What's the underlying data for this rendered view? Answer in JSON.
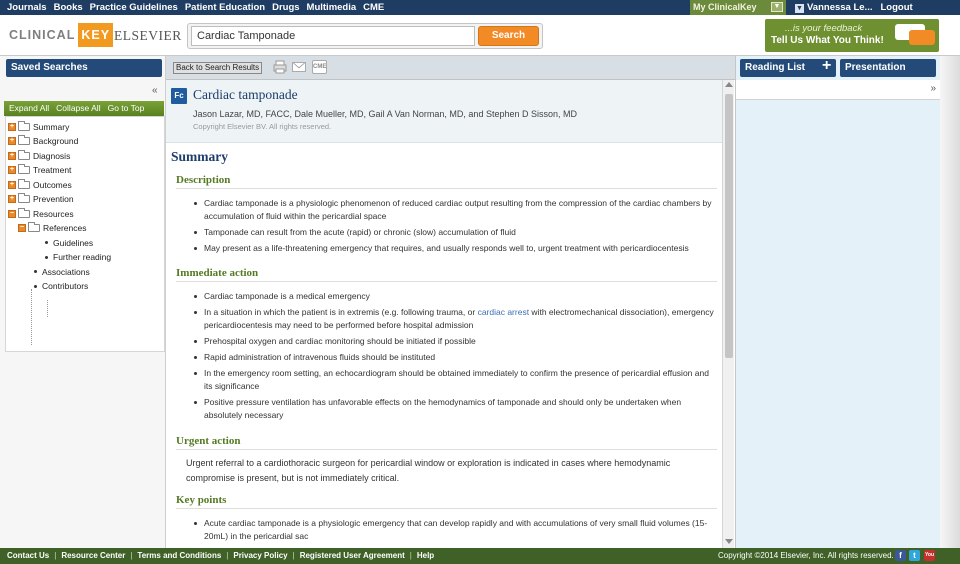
{
  "topnav": {
    "items": [
      "Journals",
      "Books",
      "Practice Guidelines",
      "Patient Education",
      "Drugs",
      "Multimedia",
      "CME"
    ],
    "my_clinicalkey": "My ClinicalKey",
    "user": "Vannessa Le...",
    "logout": "Logout"
  },
  "header": {
    "logo_clinical": "CLINICAL",
    "logo_key": "KEY",
    "logo_elsevier": "ELSEVIER",
    "search_value": "Cardiac Tamponade",
    "search_button": "Search",
    "feedback_line1": "...is your feedback",
    "feedback_line2": "Tell Us What You Think!"
  },
  "left": {
    "saved_searches": "Saved Searches",
    "collapse_icon": "«",
    "expand_all": "Expand All",
    "collapse_all": "Collapse All",
    "go_to_top": "Go to Top",
    "tree": [
      {
        "label": "Summary"
      },
      {
        "label": "Background"
      },
      {
        "label": "Diagnosis"
      },
      {
        "label": "Treatment"
      },
      {
        "label": "Outcomes"
      },
      {
        "label": "Prevention"
      },
      {
        "label": "Resources"
      },
      {
        "label": "References"
      },
      {
        "label": "Guidelines"
      },
      {
        "label": "Further reading"
      },
      {
        "label": "Associations"
      },
      {
        "label": "Contributors"
      }
    ]
  },
  "toolbar": {
    "back": "Back to Search Results",
    "cme_icon": "CME"
  },
  "article": {
    "badge": "Fc",
    "title": "Cardiac tamponade",
    "authors": "Jason Lazar, MD, FACC, Dale Mueller, MD, Gail A Van Norman, MD, and Stephen D Sisson, MD",
    "copyright": "Copyright Elsevier BV. All rights reserved.",
    "summary_heading": "Summary",
    "sections": {
      "description": {
        "heading": "Description",
        "items": [
          "Cardiac tamponade is a physiologic phenomenon of reduced cardiac output resulting from the compression of the cardiac chambers by accumulation of fluid within the pericardial space",
          "Tamponade can result from the acute (rapid) or chronic (slow) accumulation of fluid",
          "May present as a life-threatening emergency that requires, and usually responds well to, urgent treatment with pericardiocentesis"
        ]
      },
      "immediate": {
        "heading": "Immediate action",
        "items": [
          "Cardiac tamponade is a medical emergency",
          "In a situation in which the patient is in extremis (e.g. following trauma, or ",
          "Prehospital oxygen and cardiac monitoring should be initiated if possible",
          "Rapid administration of intravenous fluids should be instituted",
          "In the emergency room setting, an echocardiogram should be obtained immediately to confirm the presence of pericardial effusion and its significance",
          "Positive pressure ventilation has unfavorable effects on the hemodynamics of tamponade and should only be undertaken when absolutely necessary"
        ],
        "link_text": "cardiac arrest",
        "item2_tail": " with electromechanical dissociation), emergency pericardiocentesis may need to be performed before hospital admission"
      },
      "urgent": {
        "heading": "Urgent action",
        "text": "Urgent referral to a cardiothoracic surgeon for pericardial window or exploration is indicated in cases where hemodynamic compromise is present, but is not immediately critical."
      },
      "key_points": {
        "heading": "Key points",
        "items": [
          "Acute cardiac tamponade is a physiologic emergency that can develop rapidly and with accumulations of very small fluid volumes (15-20mL) in the pericardial sac"
        ]
      }
    }
  },
  "right": {
    "reading_list": "Reading List",
    "plus": "+",
    "presentation": "Presentation",
    "expand_icon": "»"
  },
  "footer": {
    "links": [
      "Contact Us",
      "Resource Center",
      "Terms and Conditions",
      "Privacy Policy",
      "Registered User Agreement",
      "Help"
    ],
    "copyright": "Copyright ©2014  Elsevier, Inc.  All rights reserved.",
    "facebook_icon": "f",
    "twitter_icon": "t",
    "youtube_icon": "You"
  },
  "colors": {
    "navy": "#1f3d63",
    "green": "#6b8a3c",
    "orange": "#f28a25",
    "footer_green": "#3f6127",
    "heading_green": "#557a23",
    "title_blue": "#1d3d6b"
  }
}
